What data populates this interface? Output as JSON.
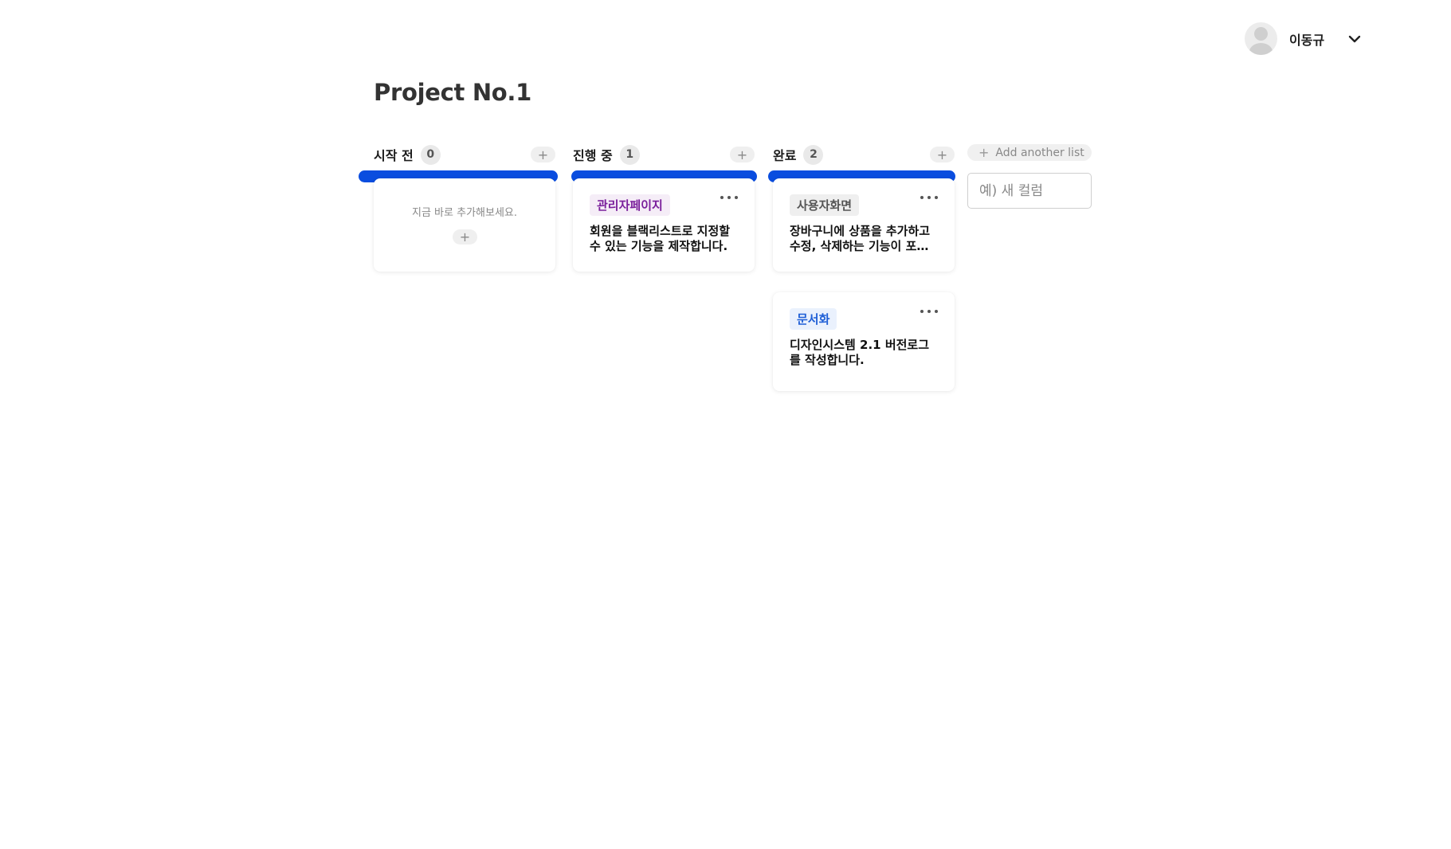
{
  "user": {
    "name": "이동규"
  },
  "project": {
    "title": "Project No.1"
  },
  "columns": [
    {
      "title": "시작 전",
      "count": "0",
      "add_label": "+",
      "empty_text": "지금 바로 추가해보세요.",
      "empty_add_label": "+"
    },
    {
      "title": "진행 중",
      "count": "1",
      "add_label": "+"
    },
    {
      "title": "완료",
      "count": "2",
      "add_label": "+"
    }
  ],
  "cards": [
    {
      "tag": "관리자페이지",
      "tag_color": "#7a1f9b",
      "tag_bg": "#f5edf7",
      "text": "회원을 블랙리스트로 지정할 수 있는 기능을 제작합니다."
    },
    {
      "tag": "사용자화면",
      "tag_color": "#555555",
      "tag_bg": "#efefef",
      "text": "장바구니에 상품을 추가하고 수정, 삭제하는 기능이 포함됩니다."
    },
    {
      "tag": "문서화",
      "tag_color": "#1f5fd6",
      "tag_bg": "#eaf1fd",
      "text": "디자인시스템 2.1 버전로그를 작성합니다."
    }
  ],
  "add_list": {
    "label": "Add another list",
    "plus": "+"
  },
  "new_column": {
    "placeholder": "예) 새 컬럼"
  },
  "colors": {
    "accent": "#0a4ddf"
  }
}
